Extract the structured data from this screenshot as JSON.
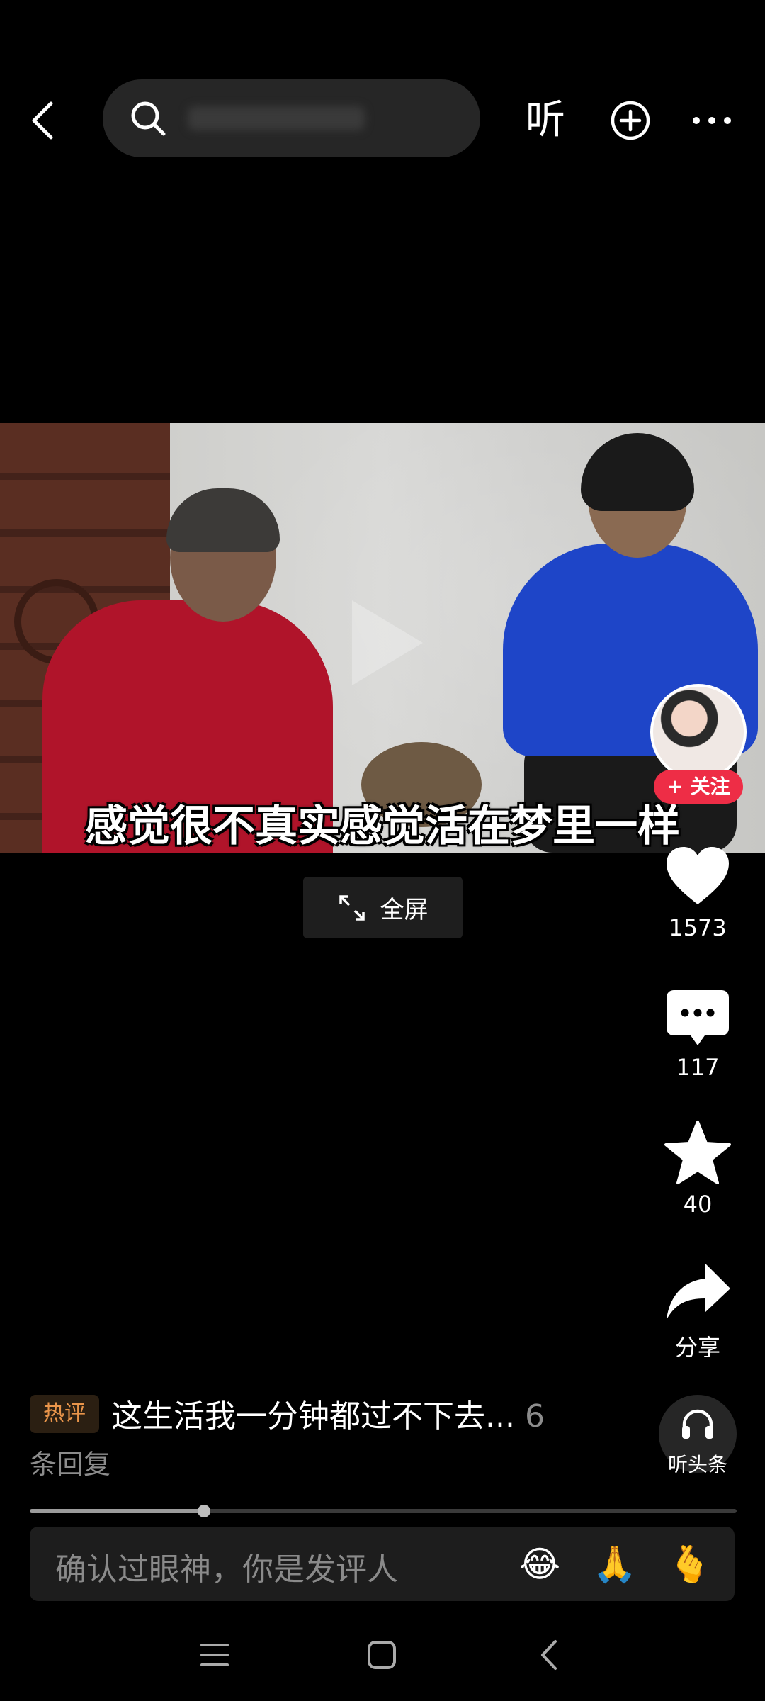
{
  "top_bar": {
    "listen_label": "听",
    "icons": [
      "back-icon",
      "search-icon",
      "add-circle-icon",
      "more-icon"
    ]
  },
  "video": {
    "subtitle": "感觉很不真实感觉活在梦里一样",
    "follow_label": "+ 关注"
  },
  "fullscreen": {
    "label": "全屏"
  },
  "actions": {
    "like_count": "1573",
    "comment_count": "117",
    "favorite_count": "40",
    "share_label": "分享",
    "listen_headline_label": "听头条"
  },
  "hot_comment": {
    "badge": "热评",
    "text": "这生活我一分钟都过不下去...",
    "reply_count": "6",
    "reply_suffix": "条回复"
  },
  "playback": {
    "progress": 0.246
  },
  "comment_input": {
    "placeholder": "确认过眼神，你是发评人",
    "emojis": [
      "😂",
      "🙏",
      "🫰"
    ]
  },
  "colors": {
    "background": "#000000",
    "follow": "#ee2d46",
    "hot_badge_text": "#e8944a"
  },
  "system_nav": [
    "menu-icon",
    "home-icon",
    "back-nav-icon"
  ]
}
